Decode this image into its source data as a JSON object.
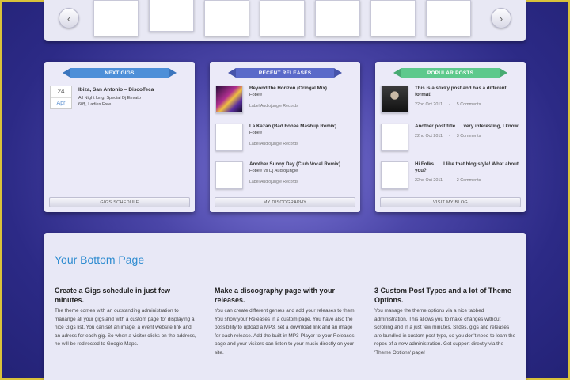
{
  "carousel": {
    "prev_icon": "chevron-left-icon",
    "next_icon": "chevron-right-icon",
    "thumb_count": 7
  },
  "widgets": {
    "gigs": {
      "title": "NEXT GIGS",
      "date_day": "24",
      "date_month": "Apr",
      "gig_title": "Ibiza, San Antonio – DiscoTeca",
      "gig_line1": "All Night long, Special Dj Envato",
      "gig_line2": "60$, Ladies Free",
      "footer": "GIGS SCHEDULE"
    },
    "releases": {
      "title": "RECENT RELEASES",
      "items": [
        {
          "title": "Beyond the Horizon (Oringal Mix)",
          "artist": "Fobee",
          "label": "Label Audiojungle Records"
        },
        {
          "title": "La Kazan (Bad Fobee Mashup Remix)",
          "artist": "Fobee",
          "label": "Label Audiojungle Records"
        },
        {
          "title": "Another Sunny Day (Club Vocal Remix)",
          "artist": "Fobee vs Dj Audiojungle",
          "label": "Label Audiojungle Records"
        }
      ],
      "footer": "MY DISCOGRAPHY"
    },
    "posts": {
      "title": "POPULAR POSTS",
      "items": [
        {
          "title": "This is a sticky post and has a different format!",
          "date": "22nd Oct 2011",
          "comments": "5 Comments"
        },
        {
          "title": "Another post title......very interesting, I know!",
          "date": "22nd Oct 2011",
          "comments": "3 Comments"
        },
        {
          "title": "Hi Folks.......I like that blog style! What about you?",
          "date": "22nd Oct 2011",
          "comments": "2 Comments"
        }
      ],
      "separator": "-",
      "footer": "VISIT MY BLOG"
    }
  },
  "bottom": {
    "title": "Your Bottom Page",
    "columns": [
      {
        "heading": "Create a Gigs schedule in just few minutes.",
        "text": "The theme comes with an outstanding administration to manange all your gigs and with a custom page for displaying a nice Gigs list. You can set an image, a event website link and an adress for each gig. So when a visitor clicks on the address, he will be redirected to Google Maps."
      },
      {
        "heading": "Make a discography page with your releases.",
        "text": "You can create different genres and add your releases to them. You show your Releases in a custom page. You have also the possibility to upload a MP3, set a download link and an image for each release. Add the built-in MP3-Player to your Releases page and your visitors can listen to your music directly on your site."
      },
      {
        "heading": "3 Custom Post Types and a lot of Theme Options.",
        "text": "You manage the theme options via a nice tabbed administration. This allows you to make changes without scrolling and in a just few minutes. Slides, gigs and releases are bundled in custom post type, so you don't need to learn the ropes of a new administration. Get support directly via the 'Theme Options' page!"
      }
    ]
  },
  "colors": {
    "accent": "#2d8bd0",
    "ribbon_gigs": "#4d8fd8",
    "ribbon_releases": "#5a6ac9",
    "ribbon_posts": "#5dc98c",
    "frame": "#d9c23a"
  }
}
